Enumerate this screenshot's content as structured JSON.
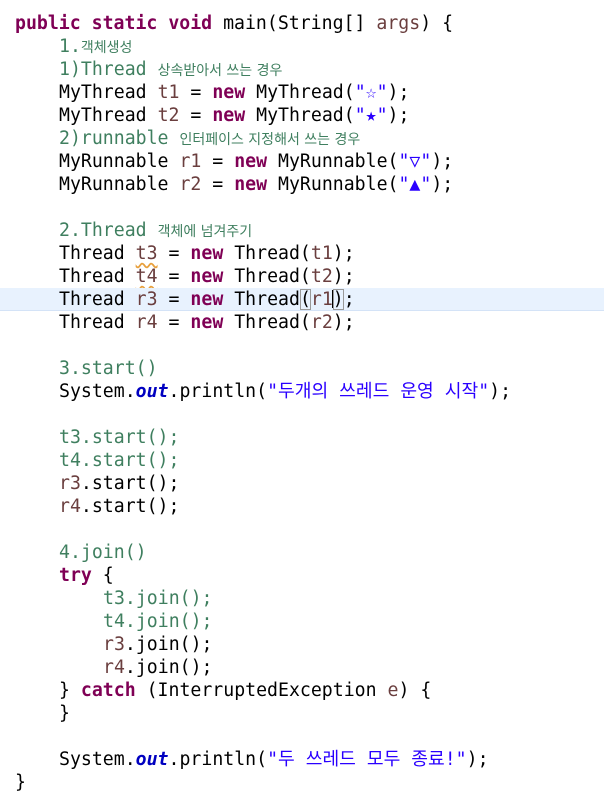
{
  "editor": {
    "lines": {
      "l1": {
        "kw1": "public",
        "kw2": "static",
        "kw3": "void",
        "rest": " main(String[] ",
        "param": "args",
        "tail": ") {"
      },
      "l2": {
        "num": "1.",
        "ko": "객체생성"
      },
      "l3": {
        "code": "1)Thread ",
        "ko": "상속받아서 쓰는 경우"
      },
      "l4": {
        "type": "MyThread ",
        "var": "t1",
        "eq": " = ",
        "kw": "new",
        "call": " MyThread(",
        "str": "\"☆\"",
        "end": ");"
      },
      "l5": {
        "type": "MyThread ",
        "var": "t2",
        "eq": " = ",
        "kw": "new",
        "call": " MyThread(",
        "str": "\"★\"",
        "end": ");"
      },
      "l6": {
        "code": "2)runnable ",
        "ko": "인터페이스 지정해서 쓰는 경우"
      },
      "l7": {
        "type": "MyRunnable ",
        "var": "r1",
        "eq": " = ",
        "kw": "new",
        "call": " MyRunnable(",
        "str": "\"▽\"",
        "end": ");"
      },
      "l8": {
        "type": "MyRunnable ",
        "var": "r2",
        "eq": " = ",
        "kw": "new",
        "call": " MyRunnable(",
        "str": "\"▲\"",
        "end": ");"
      },
      "l10": {
        "code": "2.Thread ",
        "ko": "객체에 넘겨주기"
      },
      "l11": {
        "type": "Thread ",
        "var": "t3",
        "eq": " = ",
        "kw": "new",
        "call": " Thread(",
        "arg": "t1",
        "end": ");"
      },
      "l12": {
        "type": "Thread ",
        "var": "t4",
        "eq": " = ",
        "kw": "new",
        "call": " Thread(",
        "arg": "t2",
        "end": ");"
      },
      "l13": {
        "type": "Thread ",
        "var": "r3",
        "eq": " = ",
        "kw": "new",
        "call": " Thread",
        "open": "(",
        "arg": "r1",
        "close": ")",
        "end": ";"
      },
      "l14": {
        "type": "Thread ",
        "var": "r4",
        "eq": " = ",
        "kw": "new",
        "call": " Thread(",
        "arg": "r2",
        "end": ");"
      },
      "l16": {
        "code": "3.start()"
      },
      "l17": {
        "pre": "System.",
        "field": "out",
        "call": ".println(",
        "str": "\"두개의 쓰레드 운영 시작\"",
        "end": ");"
      },
      "l19": {
        "code": "t3.start();"
      },
      "l20": {
        "code": "t4.start();"
      },
      "l21": {
        "var": "r3",
        "rest": ".start();"
      },
      "l22": {
        "var": "r4",
        "rest": ".start();"
      },
      "l24": {
        "code": "4.join()"
      },
      "l25": {
        "kw": "try",
        "rest": " {"
      },
      "l26": {
        "code": "t3.join();"
      },
      "l27": {
        "code": "t4.join();"
      },
      "l28": {
        "var": "r3",
        "rest": ".join();"
      },
      "l29": {
        "var": "r4",
        "rest": ".join();"
      },
      "l30": {
        "pre": "} ",
        "kw": "catch",
        "mid": " (InterruptedException ",
        "var": "e",
        "end": ") {"
      },
      "l31": {
        "code": "}"
      },
      "l33": {
        "pre": "System.",
        "field": "out",
        "call": ".println(",
        "str": "\"두 쓰레드 모두 종료!\"",
        "end": ");"
      },
      "l34": {
        "code": "}"
      }
    }
  }
}
